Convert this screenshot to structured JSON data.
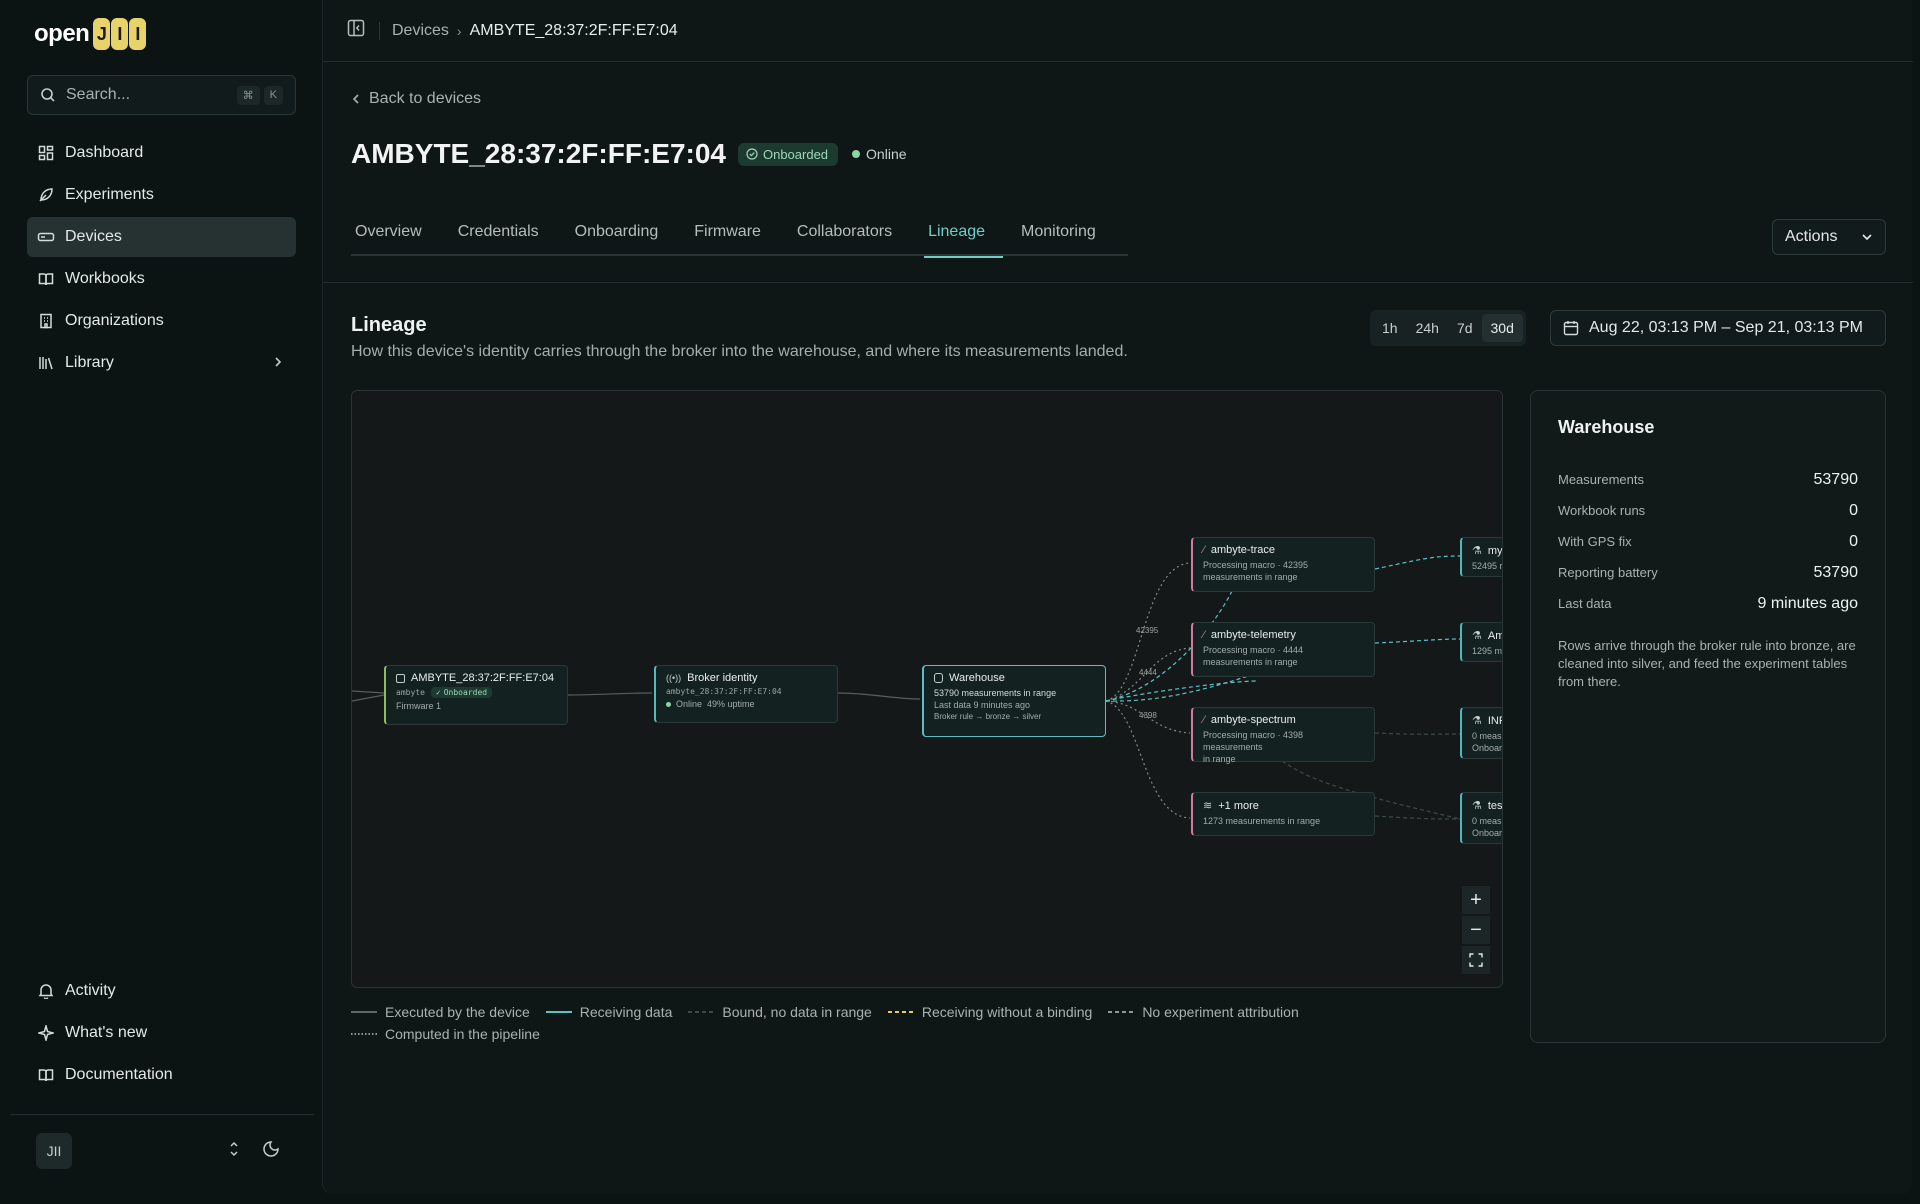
{
  "app": {
    "logo_text": "open",
    "logo_mark": "JII"
  },
  "search": {
    "placeholder": "Search...",
    "kbd1": "⌘",
    "kbd2": "K"
  },
  "nav": {
    "items": [
      {
        "label": "Dashboard",
        "icon": "dashboard-icon"
      },
      {
        "label": "Experiments",
        "icon": "leaf-icon"
      },
      {
        "label": "Devices",
        "icon": "device-icon",
        "active": true
      },
      {
        "label": "Workbooks",
        "icon": "book-icon"
      },
      {
        "label": "Organizations",
        "icon": "building-icon"
      },
      {
        "label": "Library",
        "icon": "library-icon"
      }
    ],
    "bottom": [
      {
        "label": "Activity",
        "icon": "bell-icon"
      },
      {
        "label": "What's new",
        "icon": "sparkle-icon"
      },
      {
        "label": "Documentation",
        "icon": "book-open-icon"
      }
    ],
    "user_initials": "JII"
  },
  "breadcrumb": {
    "parent": "Devices",
    "current": "AMBYTE_28:37:2F:FF:E7:04"
  },
  "back_label": "Back to devices",
  "device": {
    "title": "AMBYTE_28:37:2F:FF:E7:04",
    "status_badge": "Onboarded",
    "online": "Online"
  },
  "tabs": [
    "Overview",
    "Credentials",
    "Onboarding",
    "Firmware",
    "Collaborators",
    "Lineage",
    "Monitoring"
  ],
  "active_tab": "Lineage",
  "actions_label": "Actions",
  "lineage": {
    "title": "Lineage",
    "description": "How this device's identity carries through the broker into the warehouse, and where its measurements landed.",
    "ranges": [
      "1h",
      "24h",
      "7d",
      "30d"
    ],
    "selected_range": "30d",
    "date_range": "Aug 22, 03:13 PM – Sep 21, 03:13 PM"
  },
  "graph": {
    "device_node": {
      "title": "AMBYTE_28:37:2F:FF:E7:04",
      "sub": "ambyte",
      "badge": "Onboarded",
      "firmware": "Firmware 1"
    },
    "broker_node": {
      "title": "Broker identity",
      "sub": "ambyte_28:37:2F:FF:E7:04",
      "online": "Online",
      "uptime": "49% uptime"
    },
    "warehouse_node": {
      "title": "Warehouse",
      "line1": "53790 measurements in range",
      "line2": "Last data 9 minutes ago",
      "line3": "Broker rule → bronze → silver"
    },
    "macros": [
      {
        "title": "ambyte-trace",
        "line1": "Processing macro · 42395",
        "line2": "measurements in range"
      },
      {
        "title": "ambyte-telemetry",
        "line1": "Processing macro · 4444",
        "line2": "measurements in range"
      },
      {
        "title": "ambyte-spectrum",
        "line1": "Processing macro · 4398 measurements",
        "line2": "in range"
      },
      {
        "title": "+1 more",
        "line1": "1273 measurements in range",
        "line2": ""
      }
    ],
    "edge_labels": [
      "42395",
      "4444",
      "4398"
    ],
    "experiments": [
      {
        "title": "my",
        "line1": "52495 r",
        "line2": ""
      },
      {
        "title": "Am",
        "line1": "1295 me",
        "line2": ""
      },
      {
        "title": "INF",
        "line1": "0 meas",
        "line2": "Onboar"
      },
      {
        "title": "tes",
        "line1": "0 meas",
        "line2": "Onboar"
      }
    ],
    "zoom_in": "+",
    "zoom_out": "−",
    "fit": "⛶"
  },
  "legend": [
    "Executed by the device",
    "Receiving data",
    "Bound, no data in range",
    "Receiving without a binding",
    "No experiment attribution",
    "Computed in the pipeline"
  ],
  "colors": {
    "accent": "#6ecfc7",
    "receiving": "#58c3c9",
    "no_binding": "#e8c86a",
    "pink": "#d47b9c",
    "green": "#8bbf5a"
  },
  "warehouse_card": {
    "title": "Warehouse",
    "rows": [
      {
        "k": "Measurements",
        "v": "53790"
      },
      {
        "k": "Workbook runs",
        "v": "0"
      },
      {
        "k": "With GPS fix",
        "v": "0"
      },
      {
        "k": "Reporting battery",
        "v": "53790"
      },
      {
        "k": "Last data",
        "v": "9 minutes ago"
      }
    ],
    "description": "Rows arrive through the broker rule into bronze, are cleaned into silver, and feed the experiment tables from there."
  }
}
